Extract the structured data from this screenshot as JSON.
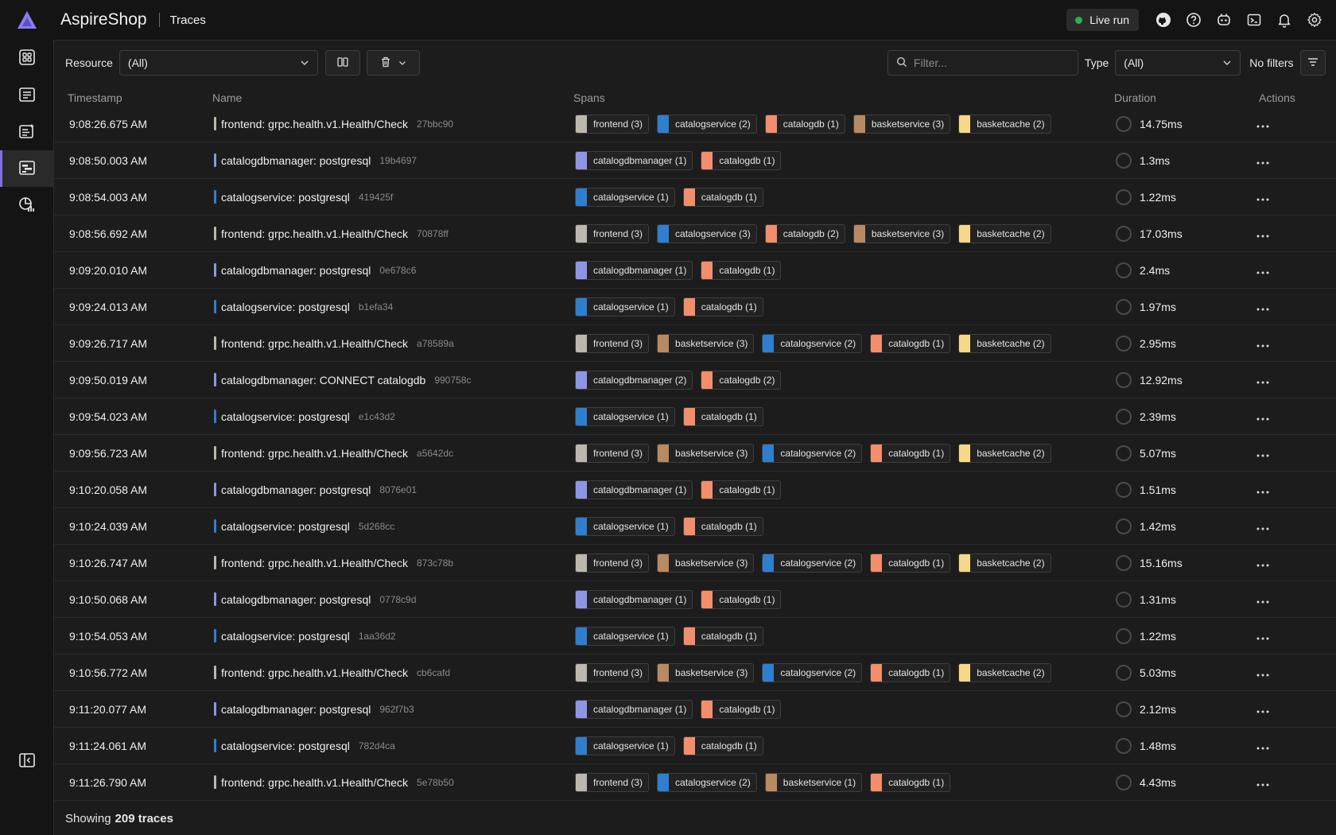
{
  "header": {
    "app_title": "AspireShop",
    "page_title": "Traces",
    "live_run_label": "Live run"
  },
  "toolbar": {
    "resource_label": "Resource",
    "resource_value": "(All)",
    "filter_placeholder": "Filter...",
    "type_label": "Type",
    "type_value": "(All)",
    "no_filters_label": "No filters"
  },
  "table": {
    "columns": [
      "Timestamp",
      "Name",
      "Spans",
      "Duration",
      "Actions"
    ],
    "rows": [
      {
        "timestamp": "9:08:26.675 AM",
        "name": "frontend: grpc.health.v1.Health/Check",
        "trace_id": "27bbc90",
        "name_color": "#bcb6ac",
        "spans": [
          {
            "label": "frontend (3)",
            "color": "#bdb8ae"
          },
          {
            "label": "catalogservice (2)",
            "color": "#2f7fd0"
          },
          {
            "label": "catalogdb (1)",
            "color": "#f28e6c"
          },
          {
            "label": "basketservice (3)",
            "color": "#b88a62"
          },
          {
            "label": "basketcache (2)",
            "color": "#f6d888"
          }
        ],
        "duration": "14.75ms"
      },
      {
        "timestamp": "9:08:50.003 AM",
        "name": "catalogdbmanager: postgresql",
        "trace_id": "19b4697",
        "name_color": "#8f95e6",
        "spans": [
          {
            "label": "catalogdbmanager (1)",
            "color": "#8f95e6"
          },
          {
            "label": "catalogdb (1)",
            "color": "#f28e6c"
          }
        ],
        "duration": "1.3ms"
      },
      {
        "timestamp": "9:08:54.003 AM",
        "name": "catalogservice: postgresql",
        "trace_id": "419425f",
        "name_color": "#2f7fd0",
        "spans": [
          {
            "label": "catalogservice (1)",
            "color": "#2f7fd0"
          },
          {
            "label": "catalogdb (1)",
            "color": "#f28e6c"
          }
        ],
        "duration": "1.22ms"
      },
      {
        "timestamp": "9:08:56.692 AM",
        "name": "frontend: grpc.health.v1.Health/Check",
        "trace_id": "70878ff",
        "name_color": "#bcb6ac",
        "spans": [
          {
            "label": "frontend (3)",
            "color": "#bdb8ae"
          },
          {
            "label": "catalogservice (3)",
            "color": "#2f7fd0"
          },
          {
            "label": "catalogdb (2)",
            "color": "#f28e6c"
          },
          {
            "label": "basketservice (3)",
            "color": "#b88a62"
          },
          {
            "label": "basketcache (2)",
            "color": "#f6d888"
          }
        ],
        "duration": "17.03ms"
      },
      {
        "timestamp": "9:09:20.010 AM",
        "name": "catalogdbmanager: postgresql",
        "trace_id": "0e678c6",
        "name_color": "#8f95e6",
        "spans": [
          {
            "label": "catalogdbmanager (1)",
            "color": "#8f95e6"
          },
          {
            "label": "catalogdb (1)",
            "color": "#f28e6c"
          }
        ],
        "duration": "2.4ms"
      },
      {
        "timestamp": "9:09:24.013 AM",
        "name": "catalogservice: postgresql",
        "trace_id": "b1efa34",
        "name_color": "#2f7fd0",
        "spans": [
          {
            "label": "catalogservice (1)",
            "color": "#2f7fd0"
          },
          {
            "label": "catalogdb (1)",
            "color": "#f28e6c"
          }
        ],
        "duration": "1.97ms"
      },
      {
        "timestamp": "9:09:26.717 AM",
        "name": "frontend: grpc.health.v1.Health/Check",
        "trace_id": "a78589a",
        "name_color": "#bcb6ac",
        "spans": [
          {
            "label": "frontend (3)",
            "color": "#bdb8ae"
          },
          {
            "label": "basketservice (3)",
            "color": "#b88a62"
          },
          {
            "label": "catalogservice (2)",
            "color": "#2f7fd0"
          },
          {
            "label": "catalogdb (1)",
            "color": "#f28e6c"
          },
          {
            "label": "basketcache (2)",
            "color": "#f6d888"
          }
        ],
        "duration": "2.95ms"
      },
      {
        "timestamp": "9:09:50.019 AM",
        "name": "catalogdbmanager: CONNECT catalogdb",
        "trace_id": "990758c",
        "name_color": "#8f95e6",
        "spans": [
          {
            "label": "catalogdbmanager (2)",
            "color": "#8f95e6"
          },
          {
            "label": "catalogdb (2)",
            "color": "#f28e6c"
          }
        ],
        "duration": "12.92ms"
      },
      {
        "timestamp": "9:09:54.023 AM",
        "name": "catalogservice: postgresql",
        "trace_id": "e1c43d2",
        "name_color": "#2f7fd0",
        "spans": [
          {
            "label": "catalogservice (1)",
            "color": "#2f7fd0"
          },
          {
            "label": "catalogdb (1)",
            "color": "#f28e6c"
          }
        ],
        "duration": "2.39ms"
      },
      {
        "timestamp": "9:09:56.723 AM",
        "name": "frontend: grpc.health.v1.Health/Check",
        "trace_id": "a5642dc",
        "name_color": "#bcb6ac",
        "spans": [
          {
            "label": "frontend (3)",
            "color": "#bdb8ae"
          },
          {
            "label": "basketservice (3)",
            "color": "#b88a62"
          },
          {
            "label": "catalogservice (2)",
            "color": "#2f7fd0"
          },
          {
            "label": "catalogdb (1)",
            "color": "#f28e6c"
          },
          {
            "label": "basketcache (2)",
            "color": "#f6d888"
          }
        ],
        "duration": "5.07ms"
      },
      {
        "timestamp": "9:10:20.058 AM",
        "name": "catalogdbmanager: postgresql",
        "trace_id": "8076e01",
        "name_color": "#8f95e6",
        "spans": [
          {
            "label": "catalogdbmanager (1)",
            "color": "#8f95e6"
          },
          {
            "label": "catalogdb (1)",
            "color": "#f28e6c"
          }
        ],
        "duration": "1.51ms"
      },
      {
        "timestamp": "9:10:24.039 AM",
        "name": "catalogservice: postgresql",
        "trace_id": "5d268cc",
        "name_color": "#2f7fd0",
        "spans": [
          {
            "label": "catalogservice (1)",
            "color": "#2f7fd0"
          },
          {
            "label": "catalogdb (1)",
            "color": "#f28e6c"
          }
        ],
        "duration": "1.42ms"
      },
      {
        "timestamp": "9:10:26.747 AM",
        "name": "frontend: grpc.health.v1.Health/Check",
        "trace_id": "873c78b",
        "name_color": "#bcb6ac",
        "spans": [
          {
            "label": "frontend (3)",
            "color": "#bdb8ae"
          },
          {
            "label": "basketservice (3)",
            "color": "#b88a62"
          },
          {
            "label": "catalogservice (2)",
            "color": "#2f7fd0"
          },
          {
            "label": "catalogdb (1)",
            "color": "#f28e6c"
          },
          {
            "label": "basketcache (2)",
            "color": "#f6d888"
          }
        ],
        "duration": "15.16ms"
      },
      {
        "timestamp": "9:10:50.068 AM",
        "name": "catalogdbmanager: postgresql",
        "trace_id": "0778c9d",
        "name_color": "#8f95e6",
        "spans": [
          {
            "label": "catalogdbmanager (1)",
            "color": "#8f95e6"
          },
          {
            "label": "catalogdb (1)",
            "color": "#f28e6c"
          }
        ],
        "duration": "1.31ms"
      },
      {
        "timestamp": "9:10:54.053 AM",
        "name": "catalogservice: postgresql",
        "trace_id": "1aa36d2",
        "name_color": "#2f7fd0",
        "spans": [
          {
            "label": "catalogservice (1)",
            "color": "#2f7fd0"
          },
          {
            "label": "catalogdb (1)",
            "color": "#f28e6c"
          }
        ],
        "duration": "1.22ms"
      },
      {
        "timestamp": "9:10:56.772 AM",
        "name": "frontend: grpc.health.v1.Health/Check",
        "trace_id": "cb6cafd",
        "name_color": "#bcb6ac",
        "spans": [
          {
            "label": "frontend (3)",
            "color": "#bdb8ae"
          },
          {
            "label": "basketservice (3)",
            "color": "#b88a62"
          },
          {
            "label": "catalogservice (2)",
            "color": "#2f7fd0"
          },
          {
            "label": "catalogdb (1)",
            "color": "#f28e6c"
          },
          {
            "label": "basketcache (2)",
            "color": "#f6d888"
          }
        ],
        "duration": "5.03ms"
      },
      {
        "timestamp": "9:11:20.077 AM",
        "name": "catalogdbmanager: postgresql",
        "trace_id": "962f7b3",
        "name_color": "#8f95e6",
        "spans": [
          {
            "label": "catalogdbmanager (1)",
            "color": "#8f95e6"
          },
          {
            "label": "catalogdb (1)",
            "color": "#f28e6c"
          }
        ],
        "duration": "2.12ms"
      },
      {
        "timestamp": "9:11:24.061 AM",
        "name": "catalogservice: postgresql",
        "trace_id": "782d4ca",
        "name_color": "#2f7fd0",
        "spans": [
          {
            "label": "catalogservice (1)",
            "color": "#2f7fd0"
          },
          {
            "label": "catalogdb (1)",
            "color": "#f28e6c"
          }
        ],
        "duration": "1.48ms"
      },
      {
        "timestamp": "9:11:26.790 AM",
        "name": "frontend: grpc.health.v1.Health/Check",
        "trace_id": "5e78b50",
        "name_color": "#bcb6ac",
        "spans": [
          {
            "label": "frontend (3)",
            "color": "#bdb8ae"
          },
          {
            "label": "catalogservice (2)",
            "color": "#2f7fd0"
          },
          {
            "label": "basketservice (1)",
            "color": "#b88a62"
          },
          {
            "label": "catalogdb (1)",
            "color": "#f28e6c"
          }
        ],
        "duration": "4.43ms"
      }
    ]
  },
  "footer": {
    "showing_prefix": "Showing",
    "showing_count": "209 traces"
  },
  "icons": {
    "topbar": [
      "github-icon",
      "help-icon",
      "copilot-icon",
      "console-icon",
      "notification-icon",
      "settings-icon"
    ],
    "sidebar": [
      "resources-icon",
      "console-logs-icon",
      "structured-logs-icon",
      "traces-icon",
      "metrics-icon",
      "collapse-icon"
    ]
  },
  "colors": {
    "accent": "#7f71e0",
    "live": "#2bb24c"
  }
}
